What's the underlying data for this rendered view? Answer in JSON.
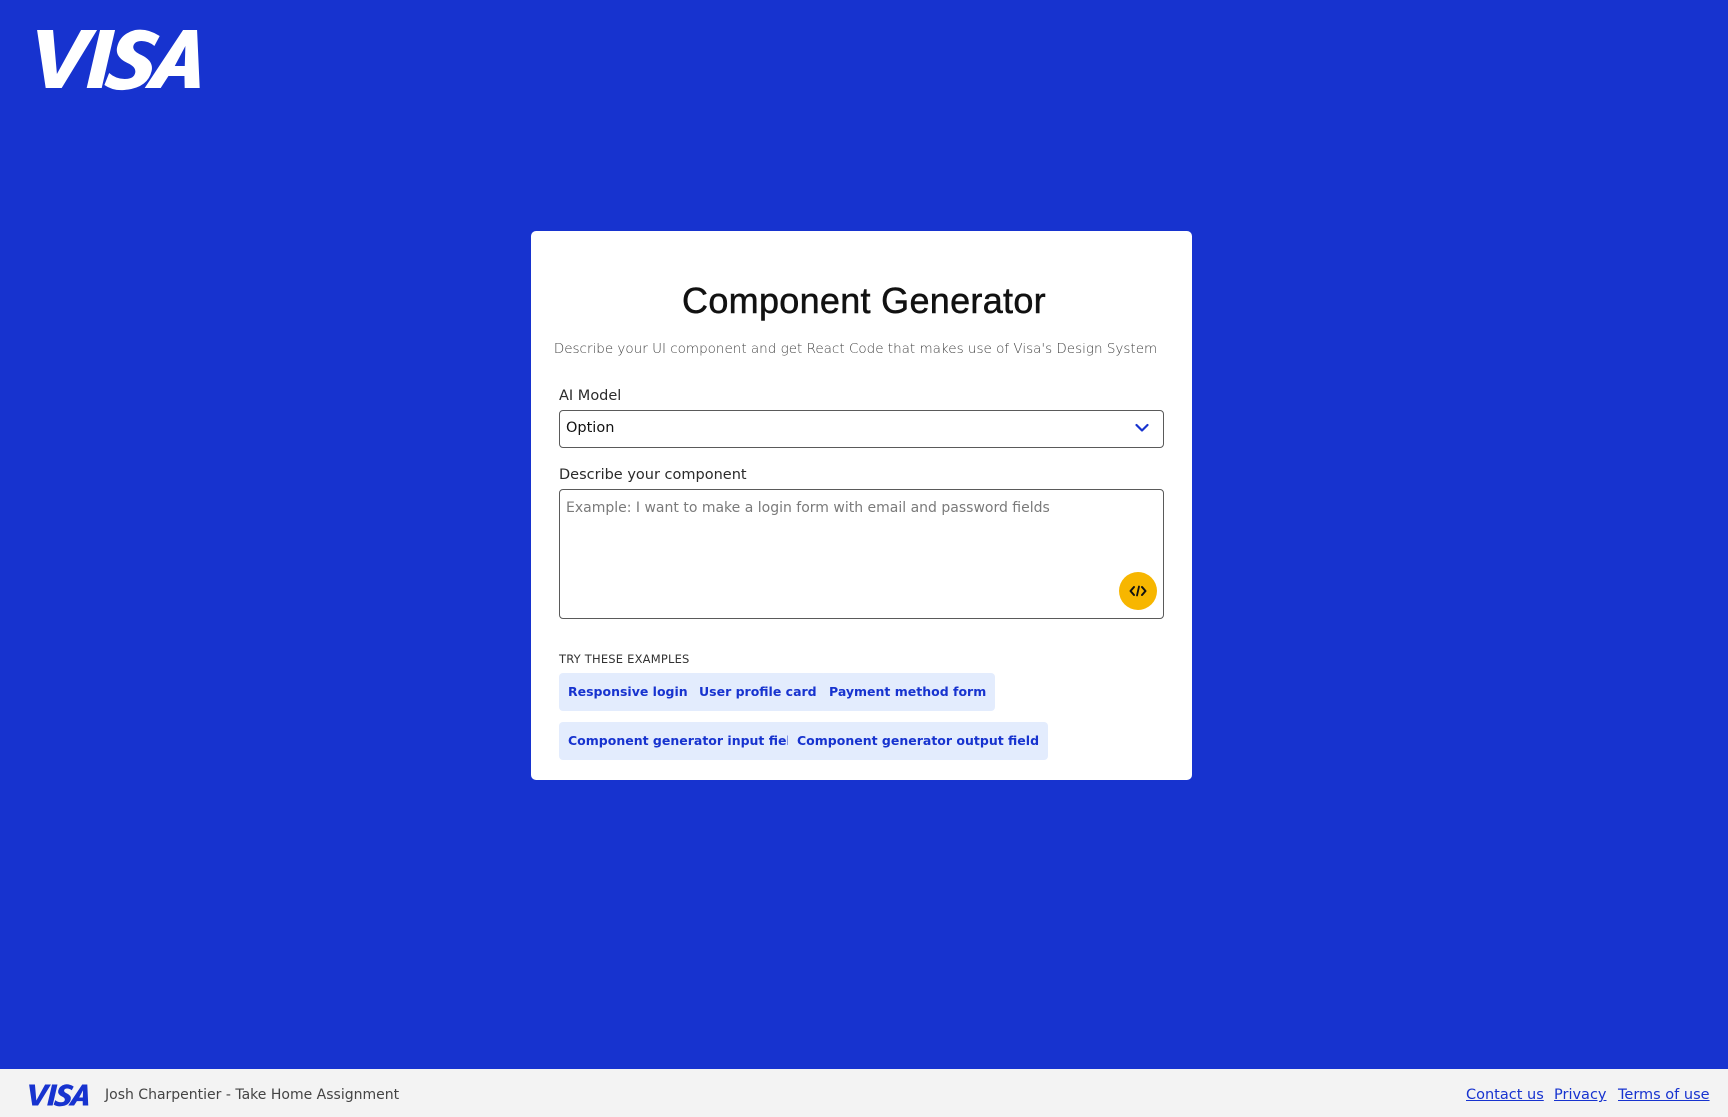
{
  "brand": {
    "logo_text": "VISA",
    "primary_color": "#1733cf",
    "accent_color": "#f7b600"
  },
  "card": {
    "title": "Component Generator",
    "subtitle": "Describe your UI component and get React Code that makes use of Visa's Design System"
  },
  "model_select": {
    "label": "AI Model",
    "value": "Option",
    "icon": "chevron-down-icon"
  },
  "description": {
    "label": "Describe your component",
    "placeholder": "Example: I want to make a login form with email and password fields",
    "value": "",
    "generate_icon": "code-icon"
  },
  "examples": {
    "label": "TRY THESE EXAMPLES",
    "items": [
      "Responsive login",
      "User profile card",
      "Payment method form",
      "Component generator input field",
      "Component generator output field"
    ]
  },
  "footer": {
    "text": "Josh Charpentier - Take Home Assignment",
    "links": [
      "Contact us",
      "Privacy",
      "Terms of use"
    ]
  }
}
